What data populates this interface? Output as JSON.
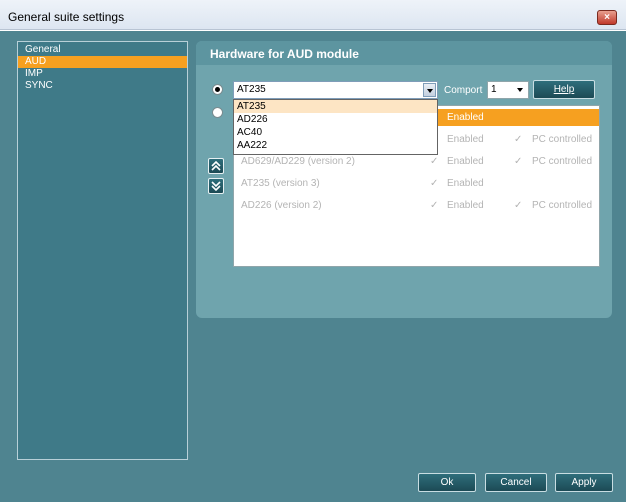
{
  "window": {
    "title": "General suite settings",
    "close_glyph": "×"
  },
  "sidebar": {
    "items": [
      {
        "label": "General",
        "selected": false
      },
      {
        "label": "AUD",
        "selected": true
      },
      {
        "label": "IMP",
        "selected": false
      },
      {
        "label": "SYNC",
        "selected": false
      }
    ]
  },
  "hardware_panel": {
    "title": "Hardware for AUD module",
    "device_combo": {
      "value": "AT235",
      "options": [
        "AT235",
        "AD226",
        "AC40",
        "AA222"
      ],
      "highlighted": "AT235"
    },
    "comport_label": "Comport",
    "comport_value": "1",
    "help_label": "Help",
    "list_rows": [
      {
        "name": "",
        "enabled_label": "Enabled",
        "pc_label": "",
        "selected": true
      },
      {
        "name": "",
        "enabled_label": "Enabled",
        "pc_label": "PC controlled",
        "selected": false
      },
      {
        "name": "AD629/AD229 (version 2)",
        "enabled_label": "Enabled",
        "pc_label": "PC controlled",
        "selected": false
      },
      {
        "name": "AT235 (version 3)",
        "enabled_label": "Enabled",
        "pc_label": "",
        "selected": false
      },
      {
        "name": "AD226 (version 2)",
        "enabled_label": "Enabled",
        "pc_label": "PC controlled",
        "selected": false
      }
    ]
  },
  "footer": {
    "ok_label": "Ok",
    "cancel_label": "Cancel",
    "apply_label": "Apply"
  },
  "colors": {
    "accent_selected": "#f6a020",
    "panel_bg": "#4f8490",
    "button_bg": "#1c4a55"
  }
}
